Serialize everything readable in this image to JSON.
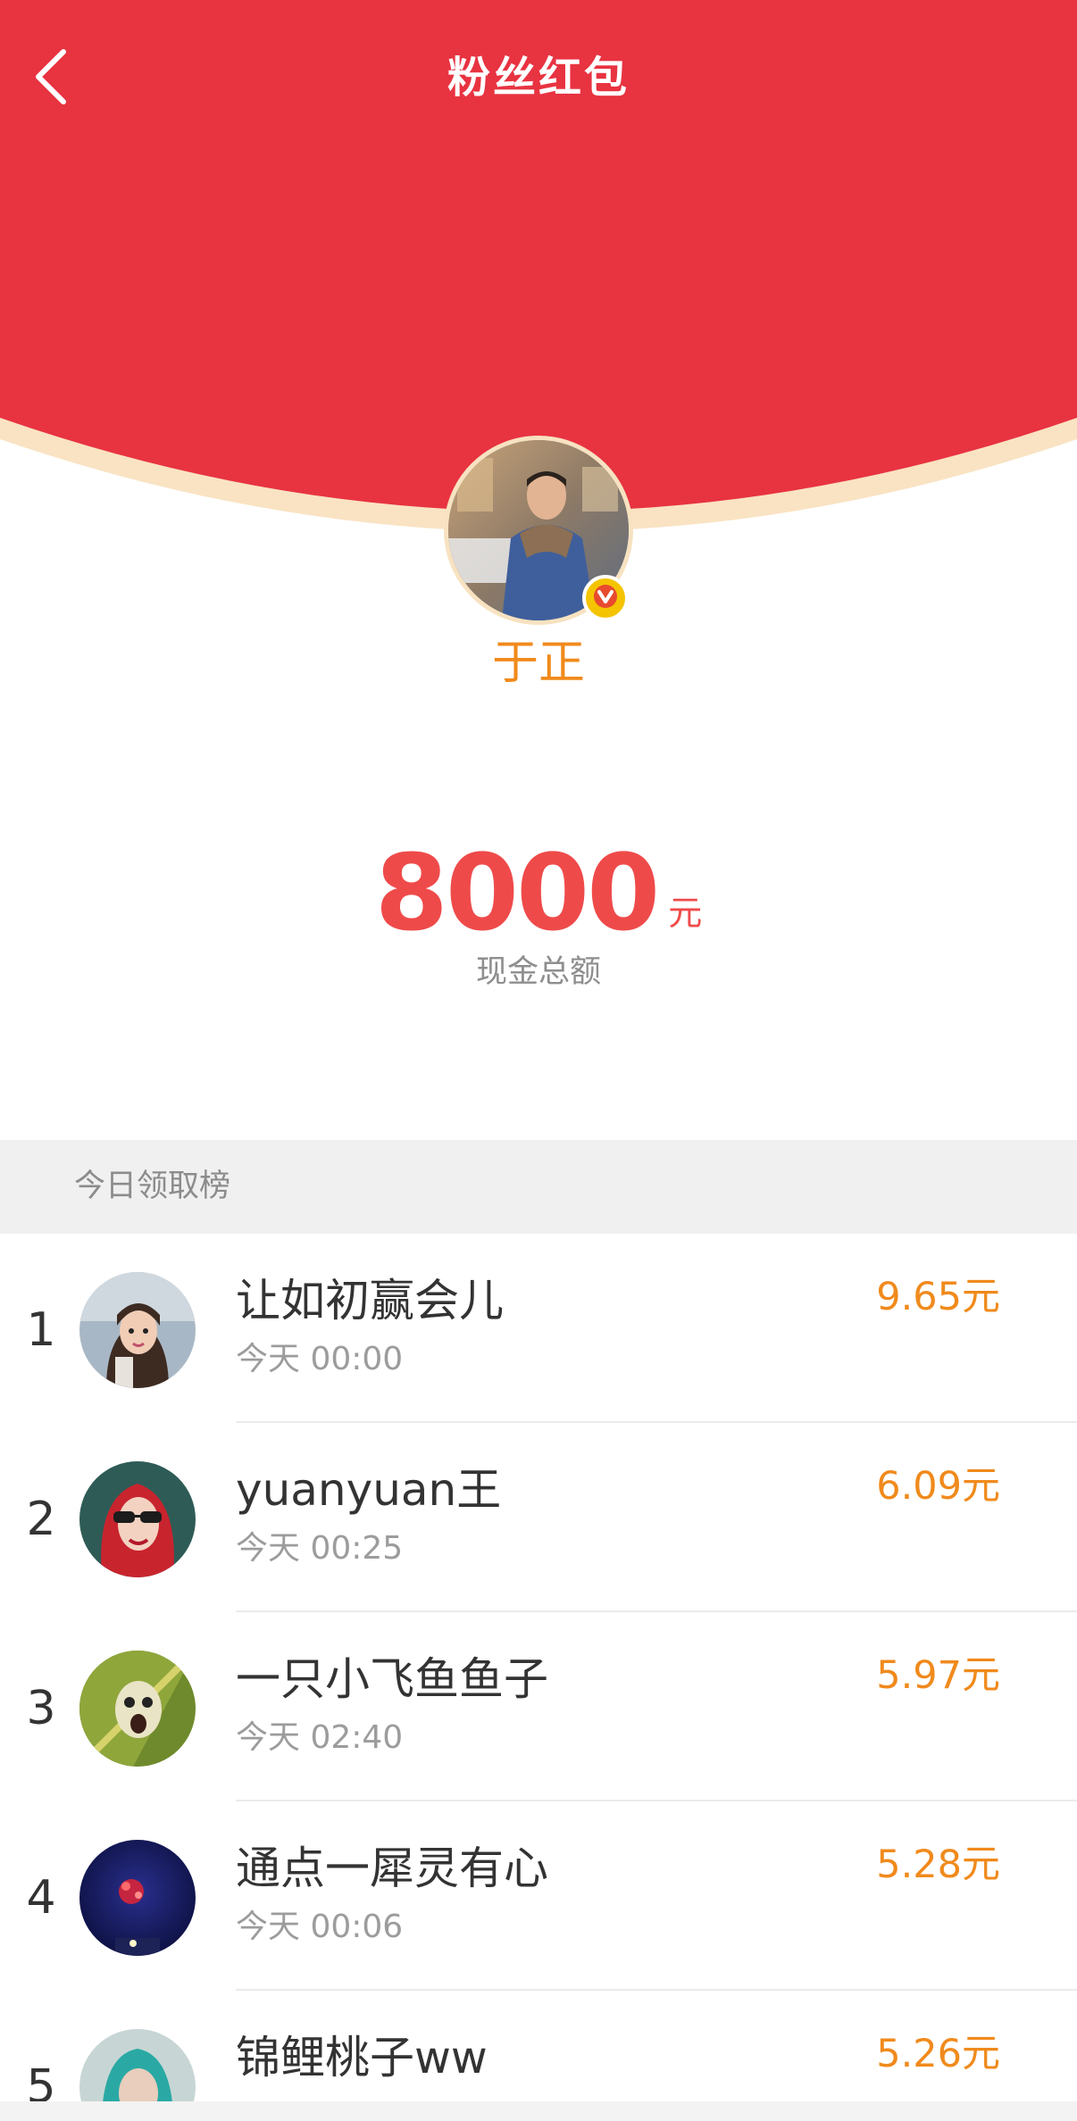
{
  "header": {
    "title": "粉丝红包",
    "back_icon": "chevron-left-icon"
  },
  "colors": {
    "header_red": "#e83341",
    "header_rim": "#f9e3c3",
    "accent_orange": "#f08a1c",
    "amount_red": "#ef4a4a"
  },
  "host": {
    "name": "于正",
    "badge_icon": "verified-v-icon",
    "badge_letter": "V"
  },
  "summary": {
    "amount": "8000",
    "unit": "元",
    "label": "现金总额"
  },
  "ranking": {
    "title": "今日领取榜",
    "items": [
      {
        "rank": "1",
        "name": "让如初赢会儿",
        "time": "今天 00:00",
        "amount": "9.65元"
      },
      {
        "rank": "2",
        "name": "yuanyuan王",
        "time": "今天 00:25",
        "amount": "6.09元"
      },
      {
        "rank": "3",
        "name": "一只小飞鱼鱼子",
        "time": "今天 02:40",
        "amount": "5.97元"
      },
      {
        "rank": "4",
        "name": "通点一犀灵有心",
        "time": "今天 00:06",
        "amount": "5.28元"
      },
      {
        "rank": "5",
        "name": "锦鲤桃子ww",
        "time": "",
        "amount": "5.26元"
      }
    ]
  }
}
